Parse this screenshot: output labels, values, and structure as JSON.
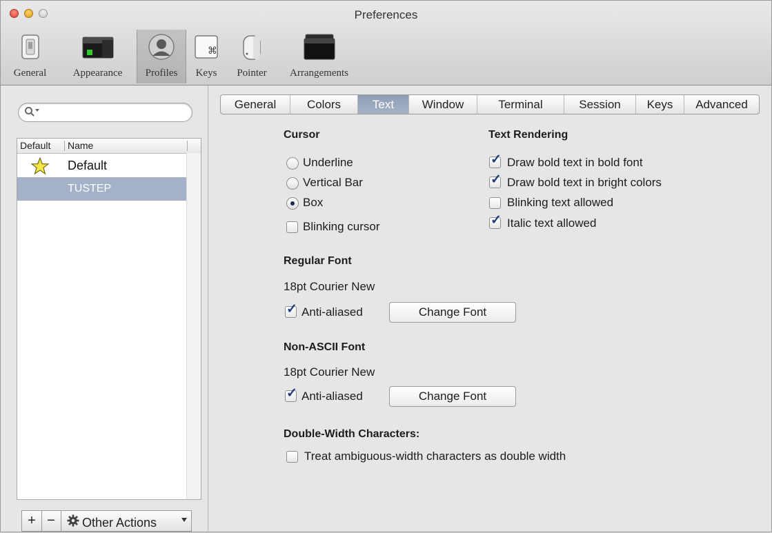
{
  "window": {
    "title": "Preferences"
  },
  "toolbar": {
    "items": [
      {
        "label": "General",
        "icon": "switch-icon"
      },
      {
        "label": "Appearance",
        "icon": "appearance-icon"
      },
      {
        "label": "Profiles",
        "icon": "profile-icon",
        "selected": true
      },
      {
        "label": "Keys",
        "icon": "command-key-icon"
      },
      {
        "label": "Pointer",
        "icon": "mouse-icon"
      },
      {
        "label": "Arrangements",
        "icon": "window-arrangement-icon"
      }
    ]
  },
  "sidebar": {
    "search": {
      "value": "",
      "placeholder": ""
    },
    "columns": {
      "default": "Default",
      "name": "Name"
    },
    "profiles": [
      {
        "name": "Default",
        "is_default": true,
        "selected": false
      },
      {
        "name": "TUSTEP",
        "is_default": false,
        "selected": true
      }
    ],
    "bottom": {
      "add": "+",
      "remove": "−",
      "actions": "Other Actions"
    }
  },
  "tabs": [
    {
      "label": "General"
    },
    {
      "label": "Colors"
    },
    {
      "label": "Text",
      "active": true
    },
    {
      "label": "Window"
    },
    {
      "label": "Terminal"
    },
    {
      "label": "Session"
    },
    {
      "label": "Keys"
    },
    {
      "label": "Advanced"
    }
  ],
  "cursor": {
    "heading": "Cursor",
    "underline": "Underline",
    "vertical_bar": "Vertical Bar",
    "box": "Box",
    "selected": "Box",
    "blinking": {
      "label": "Blinking cursor",
      "checked": false
    }
  },
  "text_rendering": {
    "heading": "Text Rendering",
    "options": [
      {
        "label": "Draw bold text in bold font",
        "checked": true
      },
      {
        "label": "Draw bold text in bright colors",
        "checked": true
      },
      {
        "label": "Blinking text allowed",
        "checked": false
      },
      {
        "label": "Italic text allowed",
        "checked": true
      }
    ]
  },
  "regular_font": {
    "heading": "Regular Font",
    "font": "18pt Courier New",
    "anti_aliased": {
      "label": "Anti-aliased",
      "checked": true
    },
    "button": "Change Font"
  },
  "non_ascii_font": {
    "heading": "Non-ASCII Font",
    "font": "18pt Courier New",
    "anti_aliased": {
      "label": "Anti-aliased",
      "checked": true
    },
    "button": "Change Font"
  },
  "double_width": {
    "heading": "Double-Width Characters:",
    "option": {
      "label": "Treat ambiguous-width characters as double width",
      "checked": false
    }
  },
  "colors": {
    "selection": "#a4b1c8",
    "tab_active": "#96a3b8",
    "check_mark": "#1e3b7a"
  }
}
